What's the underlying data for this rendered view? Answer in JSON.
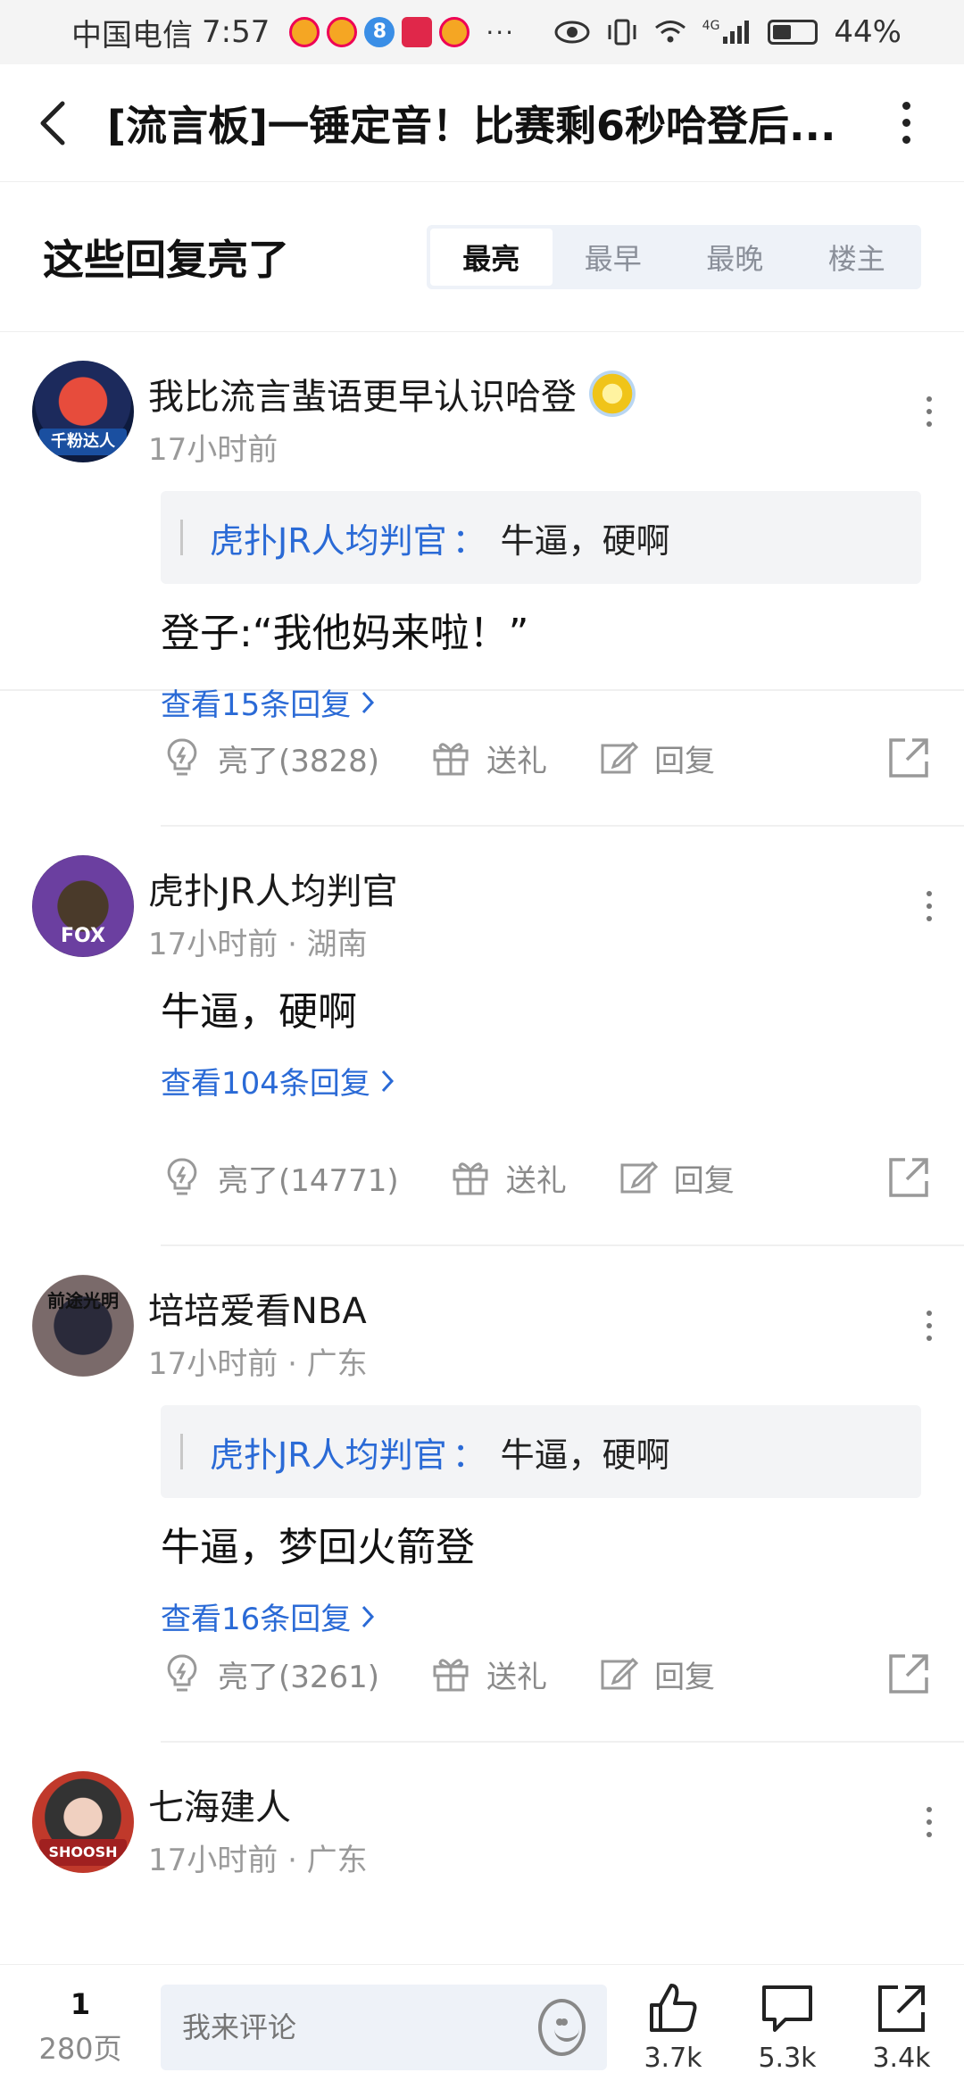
{
  "status_bar": {
    "carrier": "中国电信",
    "time": "7:57",
    "dots": "···",
    "network": "4G",
    "battery": "44%"
  },
  "nav": {
    "title": "[流言板]一锤定音！比赛剩6秒哈登后..."
  },
  "section": {
    "title": "这些回复亮了",
    "tabs": [
      {
        "label": "最亮",
        "active": true
      },
      {
        "label": "最早",
        "active": false
      },
      {
        "label": "最晚",
        "active": false
      },
      {
        "label": "楼主",
        "active": false
      }
    ]
  },
  "comments": [
    {
      "username": "我比流言蜚语更早认识哈登",
      "avatar_badge": "千粉达人",
      "meta": "17小时前",
      "quote": {
        "user": "虎扑JR人均判官",
        "sep": "：",
        "text": "牛逼，硬啊"
      },
      "text": "登子:“我他妈来啦！”",
      "view_replies": "查看15条回复",
      "light": "亮了(3828)",
      "gift": "送礼",
      "reply": "回复"
    },
    {
      "username": "虎扑JR人均判官",
      "avatar_badge": "FOX",
      "meta": "17小时前 · 湖南",
      "text": "牛逼，硬啊",
      "view_replies": "查看104条回复",
      "light": "亮了(14771)",
      "gift": "送礼",
      "reply": "回复"
    },
    {
      "username": "培培爱看NBA",
      "avatar_badge": "前途光明",
      "meta": "17小时前 · 广东",
      "quote": {
        "user": "虎扑JR人均判官",
        "sep": "：",
        "text": "牛逼，硬啊"
      },
      "text": "牛逼，梦回火箭登",
      "view_replies": "查看16条回复",
      "light": "亮了(3261)",
      "gift": "送礼",
      "reply": "回复"
    },
    {
      "username": "七海建人",
      "avatar_badge": "SHOOSH",
      "meta": "17小时前 · 广东"
    }
  ],
  "bottom_bar": {
    "page_current": "1",
    "page_total": "280页",
    "comment_placeholder": "我来评论",
    "likes": "3.7k",
    "comments": "5.3k",
    "shares": "3.4k"
  }
}
